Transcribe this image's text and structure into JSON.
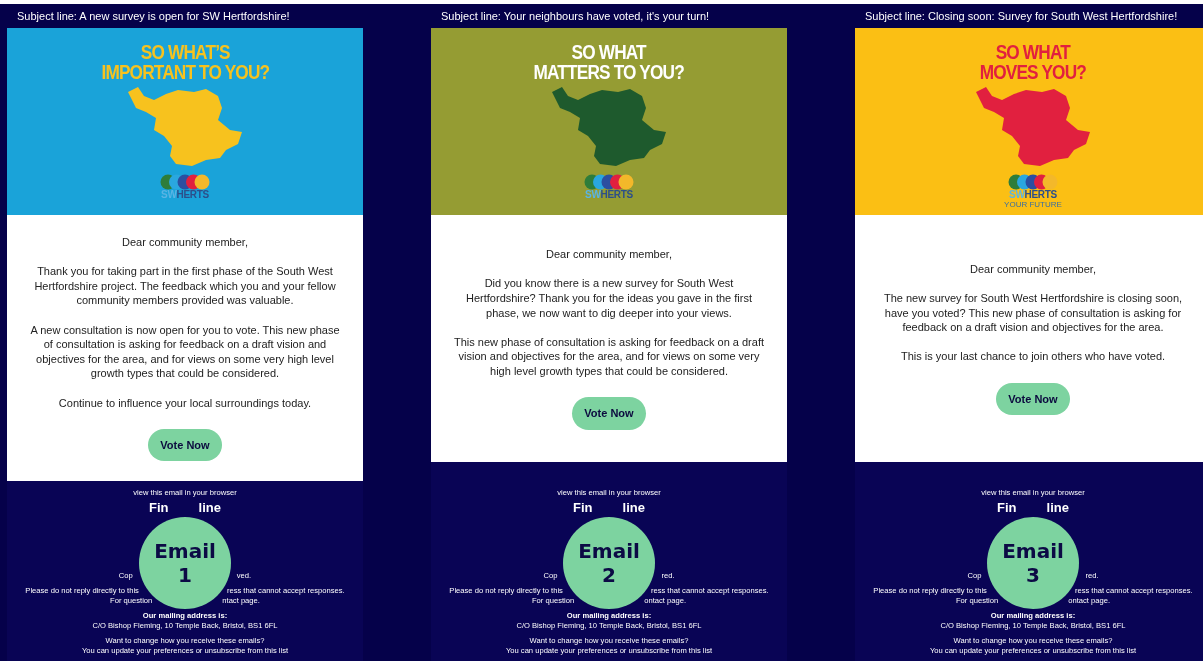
{
  "emails": [
    {
      "subject": "Subject line: A new survey is open for SW Hertfordshire!",
      "banner": {
        "color": "#1aa3d9",
        "headline": {
          "color": "#f7c21e",
          "lines": [
            "SO WHAT’S",
            "IMPORTANT TO YOU?"
          ]
        },
        "map": {
          "color": "#f7c21e"
        },
        "logo": {
          "prefix": "SW",
          "name": "HERTS"
        }
      },
      "greeting": "Dear community member,",
      "paragraphs": [
        "Thank you for taking part in the first phase of the South West Hertfordshire project. The feedback which you and your fellow community members provided was valuable.",
        "A new consultation is now open for you to vote. This new phase of consultation is asking for feedback on a draft vision and objectives for the area, and for views on some very high level growth types that could be considered.",
        "Continue to influence your local surroundings today."
      ],
      "button": "Vote Now",
      "footer": {
        "link": "view this email in your browser",
        "title": [
          "Fin",
          "line"
        ],
        "copyright": [
          "Cop",
          "ved."
        ],
        "notice": [
          "Please do not reply directly to this",
          "ress that cannot accept responses."
        ],
        "contact": {
          "before": "For question",
          "link": "ntact page",
          "after": "."
        },
        "address_label": "Our mailing address is:",
        "address": "C/O Bishop Fleming, 10 Temple Back, Bristol, BS1 6FL",
        "prefs_question": "Want to change how you receive these emails?",
        "prefs": [
          {
            "text": "You can "
          },
          {
            "link": "update your preferences"
          },
          {
            "text": " or "
          },
          {
            "link": "unsubscribe from this list"
          }
        ]
      },
      "badge": {
        "label": "Email",
        "number": "1"
      }
    },
    {
      "subject": "Subject line: Your neighbours have voted, it's your turn!",
      "banner": {
        "color": "#959c33",
        "headline": {
          "color": "#ffffff",
          "lines": [
            "SO WHAT",
            "MATTERS TO YOU?"
          ]
        },
        "map": {
          "color": "#1e5a2d"
        },
        "logo": {
          "prefix": "SW",
          "name": "HERTS"
        }
      },
      "greeting": "Dear community member,",
      "paragraphs": [
        "Did you know there is a new survey for South West Hertfordshire? Thank you for the ideas you gave in the first phase, we now want to dig deeper into your views.",
        "This new phase of consultation is asking for feedback on a draft vision and objectives for the area, and for views on some very high level growth types that could be considered."
      ],
      "button": "Vote Now",
      "footer": {
        "link": "view this email in your browser",
        "title": [
          "Fin",
          "line"
        ],
        "copyright": [
          "Cop",
          "red."
        ],
        "notice": [
          "Please do not reply directly to this",
          "ress that cannot accept responses."
        ],
        "contact": {
          "before": "For question",
          "link": "ontact page",
          "after": "."
        },
        "address_label": "Our mailing address is:",
        "address": "C/O Bishop Fleming, 10 Temple Back, Bristol, BS1 6FL",
        "prefs_question": "Want to change how you receive these emails?",
        "prefs": [
          {
            "text": "You can "
          },
          {
            "link": "update your preferences"
          },
          {
            "text": " or "
          },
          {
            "link": "unsubscribe from this list"
          }
        ]
      },
      "badge": {
        "label": "Email",
        "number": "2"
      }
    },
    {
      "subject": "Subject line: Closing soon: Survey for South West Hertfordshire!",
      "banner": {
        "color": "#fbbf14",
        "headline": {
          "color": "#e1203f",
          "lines": [
            "SO WHAT",
            "MOVES YOU?"
          ]
        },
        "map": {
          "color": "#e1203f"
        },
        "logo": {
          "prefix": "SW",
          "name": "HERTS",
          "tagline": "YOUR FUTURE"
        }
      },
      "greeting": "Dear community member,",
      "paragraphs": [
        "The new survey for South West Hertfordshire is closing soon, have you voted? This new phase of consultation is asking for feedback on a draft vision and objectives for the area.",
        "This is your last chance to join others who have voted."
      ],
      "button": "Vote Now",
      "footer": {
        "link": "view this email in your browser",
        "title": [
          "Fin",
          "line"
        ],
        "copyright": [
          "Cop",
          "red."
        ],
        "notice": [
          "Please do not reply directly to this",
          "ress that cannot accept responses."
        ],
        "contact": {
          "before": "For question",
          "link": "ontact page",
          "after": "."
        },
        "address_label": "Our mailing address is:",
        "address": "C/O Bishop Fleming, 10 Temple Back, Bristol, BS1 6FL",
        "prefs_question": "Want to change how you receive these emails?",
        "prefs": [
          {
            "text": "You can "
          },
          {
            "link": "update your preferences"
          },
          {
            "text": " or "
          },
          {
            "link": "unsubscribe from this list"
          }
        ]
      },
      "badge": {
        "label": "Email",
        "number": "3"
      }
    }
  ]
}
